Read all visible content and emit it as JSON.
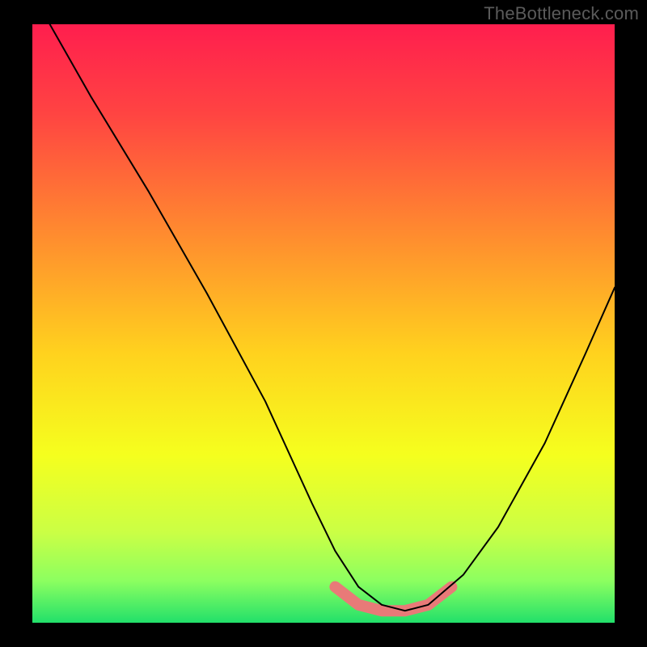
{
  "watermark": "TheBottleneck.com",
  "chart_data": {
    "type": "line",
    "title": "",
    "xlabel": "",
    "ylabel": "",
    "xlim": [
      0,
      100
    ],
    "ylim": [
      0,
      100
    ],
    "series": [
      {
        "name": "curve",
        "x": [
          3,
          10,
          20,
          30,
          40,
          48,
          52,
          56,
          60,
          64,
          68,
          74,
          80,
          88,
          95,
          100
        ],
        "y": [
          100,
          88,
          72,
          55,
          37,
          20,
          12,
          6,
          3,
          2,
          3,
          8,
          16,
          30,
          45,
          56
        ]
      }
    ],
    "highlight_segment": {
      "x": [
        52,
        56,
        60,
        64,
        68,
        72
      ],
      "y": [
        6,
        3,
        2,
        2,
        3,
        6
      ]
    },
    "gradient_stops": [
      {
        "offset": 0.0,
        "color": "#ff1e4e"
      },
      {
        "offset": 0.15,
        "color": "#ff4442"
      },
      {
        "offset": 0.35,
        "color": "#ff8b2f"
      },
      {
        "offset": 0.55,
        "color": "#ffd21e"
      },
      {
        "offset": 0.72,
        "color": "#f5ff1e"
      },
      {
        "offset": 0.85,
        "color": "#caff45"
      },
      {
        "offset": 0.93,
        "color": "#8cff60"
      },
      {
        "offset": 1.0,
        "color": "#22e06a"
      }
    ],
    "highlight_color": "#e87a78",
    "highlight_width": 14,
    "curve_color": "#000000",
    "curve_width": 2
  }
}
